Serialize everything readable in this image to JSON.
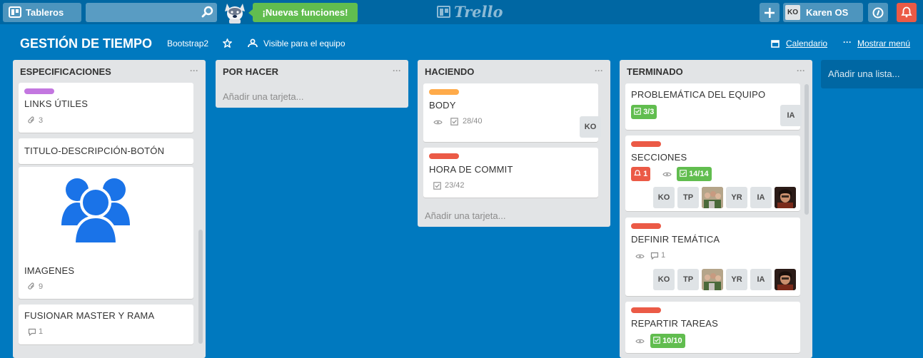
{
  "topbar": {
    "boards_label": "Tableros",
    "search_placeholder": "",
    "news_label": "¡Nuevas funciones!",
    "logo_text": "Trello",
    "user_initials": "KO",
    "user_name": "Karen OS"
  },
  "board": {
    "title": "GESTIÓN DE TIEMPO",
    "team": "Bootstrap2",
    "visibility": "Visible para el equipo",
    "calendar": "Calendario",
    "menu": "Mostrar menú"
  },
  "lists": [
    {
      "title": "ESPECIFICACIONES",
      "cards": [
        {
          "title": "LINKS ÚTILES",
          "label_color": "#c377e0",
          "attachments": "3"
        },
        {
          "title": "TITULO-DESCRIPCIÓN-BOTÓN"
        },
        {
          "title": "IMAGENES",
          "attachments": "9"
        },
        {
          "title": "FUSIONAR MASTER Y RAMA",
          "comments": "1"
        }
      ]
    },
    {
      "title": "POR HACER",
      "add_card": "Añadir una tarjeta..."
    },
    {
      "title": "HACIENDO",
      "cards": [
        {
          "title": "BODY",
          "label_color": "#ffab4a",
          "checklist": "28/40",
          "member": "KO"
        },
        {
          "title": "HORA DE COMMIT",
          "label_color": "#eb5a46",
          "checklist": "23/42"
        }
      ],
      "add_card": "Añadir una tarjeta..."
    },
    {
      "title": "TERMINADO",
      "cards": [
        {
          "title": "PROBLEMÁTICA DEL EQUIPO",
          "checklist": "3/3",
          "member": "IA"
        },
        {
          "title": "SECCIONES",
          "label_color": "#eb5a46",
          "notifications": "1",
          "checklist": "14/14",
          "members": [
            "KO",
            "TP",
            "YR",
            "IA"
          ]
        },
        {
          "title": "DEFINIR TEMÁTICA",
          "label_color": "#eb5a46",
          "comments": "1",
          "members": [
            "KO",
            "TP",
            "YR",
            "IA"
          ]
        },
        {
          "title": "REPARTIR TAREAS",
          "label_color": "#eb5a46",
          "checklist": "10/10"
        }
      ]
    }
  ],
  "add_list": "Añadir una lista..."
}
